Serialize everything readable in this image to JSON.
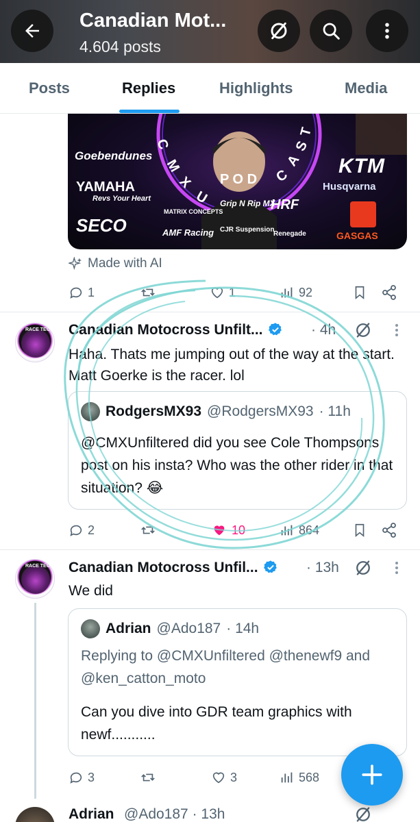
{
  "header": {
    "title": "Canadian Mot...",
    "post_count": "4.604 posts",
    "icons": [
      "back-arrow-icon",
      "muted-slash-icon",
      "search-icon",
      "more-vertical-icon"
    ]
  },
  "tabs": [
    {
      "label": "Posts",
      "active": false
    },
    {
      "label": "Replies",
      "active": true
    },
    {
      "label": "Highlights",
      "active": false
    },
    {
      "label": "Media",
      "active": false
    }
  ],
  "accent_color": "#1d9bf0",
  "like_color": "#f91880",
  "banner": {
    "podcast_text": "CMXU PODCAST",
    "sponsors": [
      "Goebendunes",
      "YAMAHA",
      "Revs Your Heart",
      "KTM",
      "Husqvarna",
      "SECO",
      "MATRIX CONCEPTS",
      "Grip N Rip MX",
      "HRF",
      "AMF Racing",
      "CJR Suspension",
      "Renegade",
      "GASGAS"
    ],
    "ai_label": "Made with AI",
    "stats": {
      "replies": "1",
      "reposts": "",
      "likes": "1",
      "views": "92"
    }
  },
  "tweets": [
    {
      "name": "Canadian Motocross Unfilt...",
      "time": "· 4h",
      "text": "Haha. Thats me jumping out of the way at the start. Matt Goerke is the racer. lol",
      "avatar_caption": "RACE TECH",
      "quote": {
        "name": "RodgersMX93",
        "handle": "@RodgersMX93",
        "time": "· 11h",
        "text": "@CMXUnfiltered did you see Cole Thompsons post on his insta? Who was the other rider in that situation? 😂"
      },
      "stats": {
        "replies": "2",
        "reposts": "",
        "likes": "10",
        "views": "864",
        "liked": true
      }
    },
    {
      "name": "Canadian Motocross Unfil...",
      "time": "· 13h",
      "text": "We did",
      "avatar_caption": "RACE TECH",
      "quote": {
        "name": "Adrian",
        "handle": "@Ado187",
        "time": "· 14h",
        "replying_to": "Replying to @CMXUnfiltered @thenewf9 and @ken_catton_moto",
        "text": "Can you dive into GDR team graphics with newf..........."
      },
      "stats": {
        "replies": "3",
        "reposts": "",
        "likes": "3",
        "views": "568",
        "liked": false
      }
    },
    {
      "name": "Adrian",
      "handle": "@Ado187",
      "time": "· 13h"
    }
  ],
  "fab": {
    "icon": "plus-icon"
  }
}
